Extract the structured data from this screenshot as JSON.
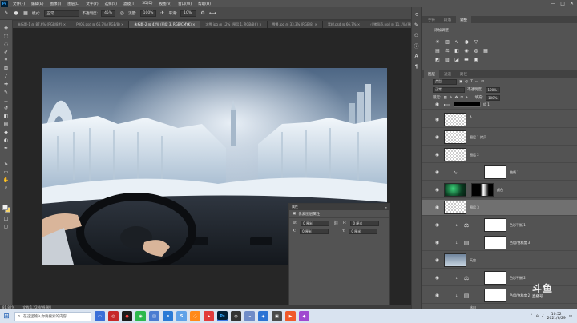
{
  "menubar": {
    "logo": "Ps",
    "items": [
      "文件(F)",
      "编辑(E)",
      "图像(I)",
      "图层(L)",
      "文字(Y)",
      "选择(S)",
      "滤镜(T)",
      "3D(D)",
      "视图(V)",
      "窗口(W)",
      "帮助(H)"
    ],
    "controls": [
      "—",
      "□",
      "✕"
    ]
  },
  "optionsbar": {
    "mode_label": "模式:",
    "mode_value": "正常",
    "opacity_label": "不透明度:",
    "opacity_value": "45%",
    "flow_label": "流量:",
    "flow_value": "100%",
    "smooth_label": "平滑:",
    "smooth_value": "10%"
  },
  "tabs": [
    {
      "label": "未标题-1 @ 87.6% (RGB/8#) ×",
      "active": false
    },
    {
      "label": "P006.psd @ 66.7% (RGB/8) ×",
      "active": false
    },
    {
      "label": "未标题-2 @ 42% (图层 3, RGB/CMYK) ×",
      "active": true
    },
    {
      "label": "冰雪 jpg @ 12% (图层 1, RGB/8#) ×",
      "active": false
    },
    {
      "label": "雪景.jpg @ 33.3% (RGB/8) ×",
      "active": false
    },
    {
      "label": "素材.psd @ 66.7% ×",
      "active": false
    },
    {
      "label": "小猪佩奇.psd @ 11.1% (图层 ×",
      "active": false
    }
  ],
  "properties": {
    "title": "属性",
    "subtitle": "像素图层属性",
    "w_label": "W:",
    "w_value": "0 厘米",
    "h_label": "H:",
    "h_value": "0 厘米",
    "x_label": "X:",
    "x_value": "0 厘米",
    "y_label": "Y:",
    "y_value": "0 厘米"
  },
  "statusbar": {
    "zoom": "81.82%",
    "doc": "文档:1.22M/99.9M"
  },
  "rightpanels": {
    "top_tabs": [
      "字符",
      "段落",
      "调整"
    ],
    "adjust_title": "添加调整",
    "layers_tabs": [
      "图层",
      "通道",
      "路径"
    ],
    "filter_label": "类型",
    "blend_value": "正常",
    "opacity_label": "不透明度:",
    "opacity_value": "100%",
    "lock_label": "锁定:",
    "fill_label": "填充:",
    "fill_value": "100%"
  },
  "layers": [
    {
      "name": "组 1",
      "thumb": "bar"
    },
    {
      "name": "A",
      "thumb": "checker"
    },
    {
      "name": "图层 1 拷贝",
      "thumb": "checker"
    },
    {
      "name": "图层 2",
      "thumb": "checker"
    },
    {
      "name": "曲线 1",
      "thumb": "adj-curves"
    },
    {
      "name": "颜色",
      "thumb": "green"
    },
    {
      "name": "图层 3",
      "thumb": "checker"
    },
    {
      "name": "色彩平衡 1",
      "thumb": "adj-balance"
    },
    {
      "name": "色相/饱和度 3",
      "thumb": "adj-hue"
    },
    {
      "name": "天空",
      "thumb": "sky"
    },
    {
      "name": "色彩平衡 2",
      "thumb": "adj-balance"
    },
    {
      "name": "色相/饱和度 2",
      "thumb": "adj-hue"
    },
    {
      "name": "冰川",
      "thumb": "ice"
    }
  ],
  "taskbar": {
    "search_placeholder": "在这里输入你要搜索的内容",
    "clock_time": "10:52",
    "clock_date": "2021/6/29"
  },
  "watermark": {
    "brand": "斗鱼",
    "subtitle": "直播号"
  }
}
